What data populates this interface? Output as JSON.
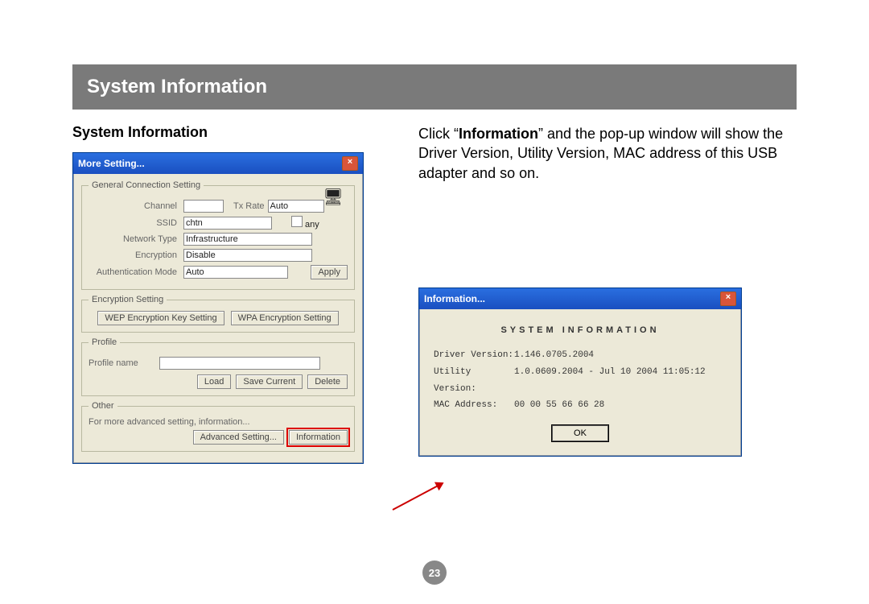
{
  "page": {
    "title_bar": "System Information",
    "section_heading": "System Information",
    "instructions_quote_open": "Click “",
    "instructions_bold": "Information",
    "instructions_rest": "” and the pop-up window will show the Driver Version, Utility Version, MAC address of this USB adapter and so on.",
    "page_number": "23"
  },
  "more_setting_window": {
    "title": "More Setting...",
    "close": "×",
    "general_legend": "General Connection Setting",
    "channel_label": "Channel",
    "channel_value": "",
    "txrate_label": "Tx Rate",
    "txrate_value": "Auto",
    "ssid_label": "SSID",
    "ssid_value": "chtn",
    "any_label": "any",
    "network_type_label": "Network Type",
    "network_type_value": "Infrastructure",
    "encryption_label": "Encryption",
    "encryption_value": "Disable",
    "auth_label": "Authentication Mode",
    "auth_value": "Auto",
    "apply_btn": "Apply",
    "encryption_legend": "Encryption Setting",
    "wep_btn": "WEP Encryption Key Setting",
    "wpa_btn": "WPA Encryption Setting",
    "profile_legend": "Profile",
    "profile_name_label": "Profile name",
    "profile_name_value": "",
    "load_btn": "Load",
    "save_btn": "Save Current",
    "delete_btn": "Delete",
    "other_legend": "Other",
    "other_text": "For more advanced setting, information...",
    "advanced_btn": "Advanced Setting...",
    "info_btn": "Information"
  },
  "info_window": {
    "title": "Information...",
    "close": "×",
    "heading": "SYSTEM INFORMATION",
    "driver_label": "Driver Version:",
    "driver_value": "1.146.0705.2004",
    "utility_label": "Utility Version:",
    "utility_value": "1.0.0609.2004 - Jul 10 2004 11:05:12",
    "mac_label": "MAC Address:",
    "mac_value": "00 00 55 66 66 28",
    "ok_btn": "OK"
  }
}
